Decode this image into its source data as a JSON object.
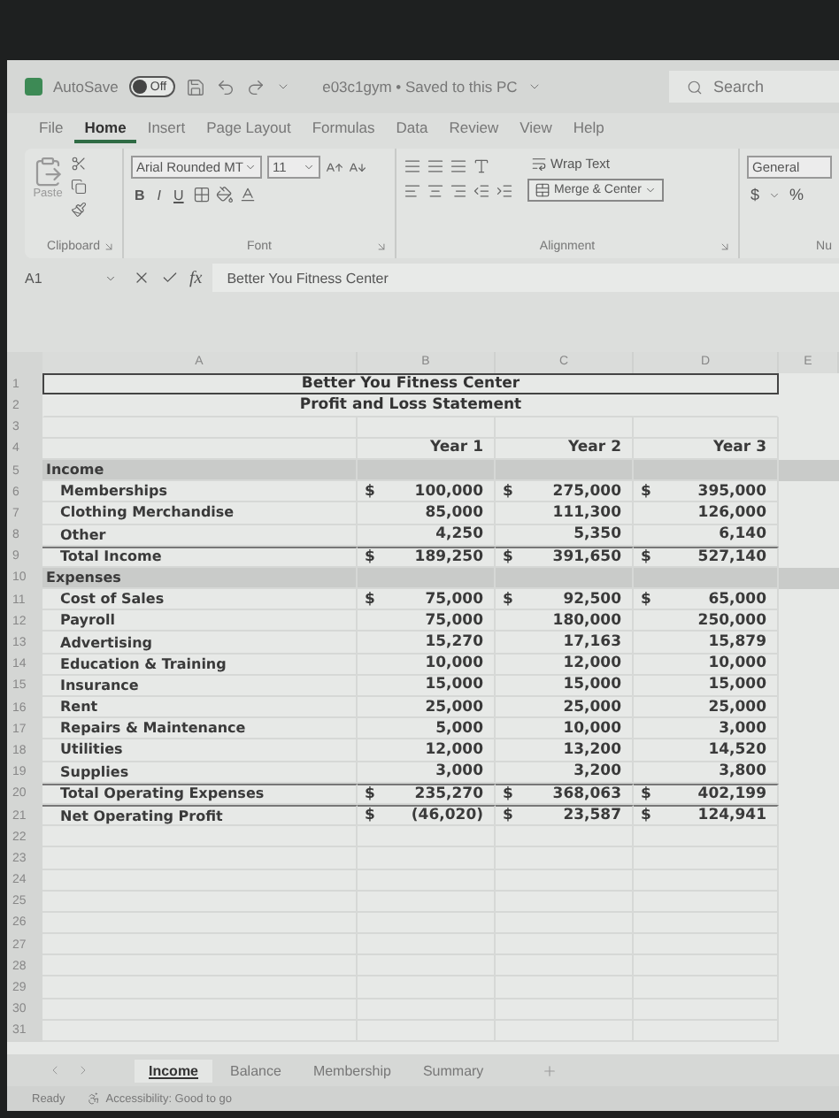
{
  "title_bar": {
    "autosave_label": "AutoSave",
    "autosave_toggle": {
      "label": "Off",
      "on": false
    },
    "filename": "e03c1gym • Saved to this PC",
    "search_placeholder": "Search"
  },
  "menu_tabs": [
    {
      "label": "File",
      "selected": false
    },
    {
      "label": "Home",
      "selected": true
    },
    {
      "label": "Insert",
      "selected": false
    },
    {
      "label": "Page Layout",
      "selected": false
    },
    {
      "label": "Formulas",
      "selected": false
    },
    {
      "label": "Data",
      "selected": false
    },
    {
      "label": "Review",
      "selected": false
    },
    {
      "label": "View",
      "selected": false
    },
    {
      "label": "Help",
      "selected": false
    }
  ],
  "ribbon": {
    "paste_label": "Paste",
    "font_name": "Arial Rounded MT",
    "font_size": "11",
    "style_buttons": [
      "B",
      "I",
      "U"
    ],
    "wrap_text": "Wrap Text",
    "merge_center": "Merge & Center",
    "number_format": "General",
    "currency": "$",
    "percent": "%",
    "groups": [
      "Clipboard",
      "Font",
      "Alignment",
      "Nu"
    ]
  },
  "formula_bar": {
    "name_box": "A1",
    "fx": "fx",
    "content": "Better You Fitness Center"
  },
  "sheet": {
    "columns": [
      "A",
      "B",
      "C",
      "D",
      "E"
    ],
    "rows": [
      {
        "number": "1",
        "kind": "title",
        "label": "Better You Fitness Center",
        "selected": true
      },
      {
        "number": "2",
        "kind": "title",
        "label": "Profit and Loss Statement",
        "selected": false
      },
      {
        "number": "3",
        "kind": "blank",
        "selected": false
      },
      {
        "number": "4",
        "kind": "header",
        "values": [
          "Year 1",
          "Year 2",
          "Year 3"
        ],
        "selected": false
      },
      {
        "number": "5",
        "kind": "section",
        "label": "Income",
        "selected": false
      },
      {
        "number": "6",
        "kind": "item",
        "label": "Memberships",
        "values": [
          {
            "symbol": "$",
            "amount": "100,000"
          },
          {
            "symbol": "$",
            "amount": "275,000"
          },
          {
            "symbol": "$",
            "amount": "395,000"
          }
        ],
        "selected": false
      },
      {
        "number": "7",
        "kind": "item",
        "label": "Clothing Merchandise",
        "values": [
          {
            "amount": "85,000"
          },
          {
            "amount": "111,300"
          },
          {
            "amount": "126,000"
          }
        ],
        "selected": false
      },
      {
        "number": "8",
        "kind": "item",
        "label": "Other",
        "values": [
          {
            "amount": "4,250"
          },
          {
            "amount": "5,350"
          },
          {
            "amount": "6,140"
          }
        ],
        "selected": false
      },
      {
        "number": "9",
        "kind": "total",
        "label": "Total Income",
        "values": [
          {
            "symbol": "$",
            "amount": "189,250"
          },
          {
            "symbol": "$",
            "amount": "391,650"
          },
          {
            "symbol": "$",
            "amount": "527,140"
          }
        ],
        "selected": false
      },
      {
        "number": "10",
        "kind": "section",
        "label": "Expenses",
        "selected": false
      },
      {
        "number": "11",
        "kind": "item",
        "label": "Cost of Sales",
        "values": [
          {
            "symbol": "$",
            "amount": "75,000"
          },
          {
            "symbol": "$",
            "amount": "92,500"
          },
          {
            "symbol": "$",
            "amount": "65,000"
          }
        ],
        "selected": false
      },
      {
        "number": "12",
        "kind": "item",
        "label": "Payroll",
        "values": [
          {
            "amount": "75,000"
          },
          {
            "amount": "180,000"
          },
          {
            "amount": "250,000"
          }
        ],
        "selected": false
      },
      {
        "number": "13",
        "kind": "item",
        "label": "Advertising",
        "values": [
          {
            "amount": "15,270"
          },
          {
            "amount": "17,163"
          },
          {
            "amount": "15,879"
          }
        ],
        "selected": false
      },
      {
        "number": "14",
        "kind": "item",
        "label": "Education & Training",
        "values": [
          {
            "amount": "10,000"
          },
          {
            "amount": "12,000"
          },
          {
            "amount": "10,000"
          }
        ],
        "selected": false
      },
      {
        "number": "15",
        "kind": "item",
        "label": "Insurance",
        "values": [
          {
            "amount": "15,000"
          },
          {
            "amount": "15,000"
          },
          {
            "amount": "15,000"
          }
        ],
        "selected": false
      },
      {
        "number": "16",
        "kind": "item",
        "label": "Rent",
        "values": [
          {
            "amount": "25,000"
          },
          {
            "amount": "25,000"
          },
          {
            "amount": "25,000"
          }
        ],
        "selected": false
      },
      {
        "number": "17",
        "kind": "item",
        "label": "Repairs & Maintenance",
        "values": [
          {
            "amount": "5,000"
          },
          {
            "amount": "10,000"
          },
          {
            "amount": "3,000"
          }
        ],
        "selected": false
      },
      {
        "number": "18",
        "kind": "item",
        "label": "Utilities",
        "values": [
          {
            "amount": "12,000"
          },
          {
            "amount": "13,200"
          },
          {
            "amount": "14,520"
          }
        ],
        "selected": false
      },
      {
        "number": "19",
        "kind": "item",
        "label": "Supplies",
        "values": [
          {
            "amount": "3,000"
          },
          {
            "amount": "3,200"
          },
          {
            "amount": "3,800"
          }
        ],
        "selected": false
      },
      {
        "number": "20",
        "kind": "total",
        "label": "Total Operating Expenses",
        "values": [
          {
            "symbol": "$",
            "amount": "235,270"
          },
          {
            "symbol": "$",
            "amount": "368,063"
          },
          {
            "symbol": "$",
            "amount": "402,199"
          }
        ],
        "selected": false
      },
      {
        "number": "21",
        "kind": "total",
        "label": "Net Operating Profit",
        "values": [
          {
            "symbol": "$",
            "amount": "(46,020)"
          },
          {
            "symbol": "$",
            "amount": "23,587"
          },
          {
            "symbol": "$",
            "amount": "124,941"
          }
        ],
        "selected": false
      },
      {
        "number": "22",
        "kind": "blank",
        "selected": false
      },
      {
        "number": "23",
        "kind": "blank",
        "selected": false
      },
      {
        "number": "24",
        "kind": "blank",
        "selected": false
      },
      {
        "number": "25",
        "kind": "blank",
        "selected": false
      },
      {
        "number": "26",
        "kind": "blank",
        "selected": false
      },
      {
        "number": "27",
        "kind": "blank",
        "selected": false
      },
      {
        "number": "28",
        "kind": "blank",
        "selected": false
      },
      {
        "number": "29",
        "kind": "blank",
        "selected": false
      },
      {
        "number": "30",
        "kind": "blank",
        "selected": false
      },
      {
        "number": "31",
        "kind": "blank",
        "selected": false
      }
    ]
  },
  "sheet_tabs": [
    {
      "label": "Income",
      "selected": true
    },
    {
      "label": "Balance",
      "selected": false
    },
    {
      "label": "Membership",
      "selected": false
    },
    {
      "label": "Summary",
      "selected": false
    }
  ],
  "status_bar": {
    "ready": "Ready",
    "accessibility": "Accessibility: Good to go"
  }
}
